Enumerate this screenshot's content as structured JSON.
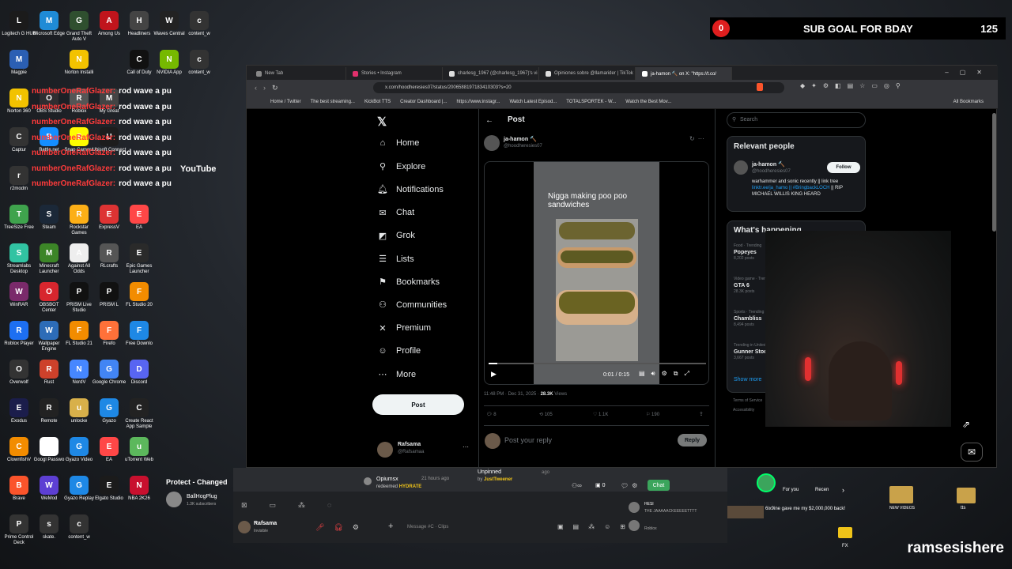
{
  "overlay": {
    "sub_goal_count": "0",
    "sub_goal_label": "SUB GOAL FOR BDAY",
    "sub_goal_target": "125",
    "brand": "ramsesishere",
    "youtube": "YouTube"
  },
  "desktop_icons": [
    {
      "label": "Logitech G HUB",
      "color": "#1b1b1b"
    },
    {
      "label": "Microsoft Edge",
      "color": "#1f8bd6"
    },
    {
      "label": "Grand Theft Auto V",
      "color": "#2f4f2f"
    },
    {
      "label": "Among Us",
      "color": "#c0141c"
    },
    {
      "label": "Headliners",
      "color": "#444"
    },
    {
      "label": "Waves Central",
      "color": "#222"
    },
    {
      "label": "content_w",
      "color": "#333"
    },
    {
      "label": "Magpie",
      "color": "#2b5fb3"
    },
    {
      "label": "Norton Installi",
      "color": "#f2c200"
    },
    {
      "label": "Call of Duty",
      "color": "#111"
    },
    {
      "label": "NVIDIA App",
      "color": "#76b900"
    },
    {
      "label": "content_w",
      "color": "#333"
    },
    {
      "label": "Norton 360",
      "color": "#f2c200"
    },
    {
      "label": "OBS Studio",
      "color": "#302e31"
    },
    {
      "label": "Roblox",
      "color": "#555"
    },
    {
      "label": "My Great",
      "color": "#444"
    },
    {
      "label": "Captur",
      "color": "#333"
    },
    {
      "label": "Battle.net",
      "color": "#148eff"
    },
    {
      "label": "Snap Camera",
      "color": "#fffc00"
    },
    {
      "label": "Ubisoft Connect",
      "color": "#1d1d1d"
    },
    {
      "label": "r2modm",
      "color": "#333"
    },
    {
      "label": "TreeSize Free",
      "color": "#3fa34d"
    },
    {
      "label": "Steam",
      "color": "#1b2838"
    },
    {
      "label": "Rockstar Games",
      "color": "#fcaf17"
    },
    {
      "label": "ExpressV",
      "color": "#d33"
    },
    {
      "label": "EA",
      "color": "#ff4747"
    },
    {
      "label": "Streamlabs Desktop",
      "color": "#31c3a2"
    },
    {
      "label": "Minecraft Launcher",
      "color": "#3c8527"
    },
    {
      "label": "Against All Odds",
      "color": "#eee"
    },
    {
      "label": "RLcrafts",
      "color": "#555"
    },
    {
      "label": "Epic Games Launcher",
      "color": "#2a2a2a"
    },
    {
      "label": "WinRAR",
      "color": "#7a2a6a"
    },
    {
      "label": "OBSBOT Center",
      "color": "#d7262e"
    },
    {
      "label": "PRISM Live Studio",
      "color": "#111"
    },
    {
      "label": "PRISM L",
      "color": "#111"
    },
    {
      "label": "FL Studio 20",
      "color": "#f28c00"
    },
    {
      "label": "Roblox Player",
      "color": "#1d6ff2"
    },
    {
      "label": "Wallpaper Engine",
      "color": "#2d6cb7"
    },
    {
      "label": "FL Studio 21",
      "color": "#f28c00"
    },
    {
      "label": "Firefo",
      "color": "#ff7139"
    },
    {
      "label": "Free Downlo",
      "color": "#1e88e5"
    },
    {
      "label": "Overwolf",
      "color": "#333"
    },
    {
      "label": "Rust",
      "color": "#cd412b"
    },
    {
      "label": "NordV",
      "color": "#4687ff"
    },
    {
      "label": "Google Chrome",
      "color": "#4285f4"
    },
    {
      "label": "Discord",
      "color": "#5865f2"
    },
    {
      "label": "Exodus",
      "color": "#1b1d4b"
    },
    {
      "label": "Remote",
      "color": "#222"
    },
    {
      "label": "unlocke",
      "color": "#d8b04a"
    },
    {
      "label": "Gyazo",
      "color": "#1e88e5"
    },
    {
      "label": "Create React App Sample",
      "color": "#222"
    },
    {
      "label": "ClownfishV",
      "color": "#f28c00"
    },
    {
      "label": "Googl Passwo",
      "color": "#fff"
    },
    {
      "label": "Gyazo Video",
      "color": "#1e88e5"
    },
    {
      "label": "EA",
      "color": "#ff4747"
    },
    {
      "label": "uTorrent Web",
      "color": "#5cb85c"
    },
    {
      "label": "Brave",
      "color": "#fb542b"
    },
    {
      "label": "WeMod",
      "color": "#5d3fd3"
    },
    {
      "label": "Gyazo Replay",
      "color": "#1e88e5"
    },
    {
      "label": "Elgato Studio",
      "color": "#1b1b1b"
    },
    {
      "label": "NBA 2K26",
      "color": "#c8102e"
    },
    {
      "label": "Prime Control Deck",
      "color": "#333"
    },
    {
      "label": "skate.",
      "color": "#333"
    },
    {
      "label": "content_w",
      "color": "#333"
    }
  ],
  "chat_lines": [
    {
      "user": "numberOneRafGlazer:",
      "msg": "rod wave a pu"
    },
    {
      "user": "numberOneRafGlazer:",
      "msg": "rod wave a pu"
    },
    {
      "user": "numberOneRafGlazer:",
      "msg": "rod wave a pu"
    },
    {
      "user": "numberOneRafGlazer:",
      "msg": "rod wave a pu"
    },
    {
      "user": "numberOneRafGlazer:",
      "msg": "rod wave a pu"
    },
    {
      "user": "numberOneRafGlazer:",
      "msg": "rod wave a pu"
    },
    {
      "user": "numberOneRafGlazer:",
      "msg": "rod wave a pu"
    }
  ],
  "browser": {
    "tabs": [
      {
        "label": "New Tab",
        "color": "#888"
      },
      {
        "label": "Stories • Instagram",
        "color": "#e1306c"
      },
      {
        "label": "charlesg_1967 (@charlesg_1967)'s vi",
        "color": "#ddd"
      },
      {
        "label": "Opiniones sobre @llamarider | TikTok",
        "color": "#ddd"
      },
      {
        "label": "ja-hamon 🔨 on X: \"https://t.co/",
        "color": "#fff"
      }
    ],
    "url": "x.com/hoodheresies07/status/2006588197183410303?s=20",
    "bookmarks": [
      "Home / Twitter",
      "The best streaming...",
      "KickBot TTS",
      "Creator Dashboard |...",
      "https://www.instagr...",
      "Watch Latest Episod...",
      "TOTALSPORTEK - W...",
      "Watch the Best Mov..."
    ],
    "all_bookmarks": "All Bookmarks"
  },
  "twitter": {
    "nav": [
      {
        "label": "Home",
        "icon": "home-icon",
        "glyph": "⌂"
      },
      {
        "label": "Explore",
        "icon": "search-icon",
        "glyph": "⚲"
      },
      {
        "label": "Notifications",
        "icon": "bell-icon",
        "glyph": "🔔︎"
      },
      {
        "label": "Chat",
        "icon": "chat-icon",
        "glyph": "✉"
      },
      {
        "label": "Grok",
        "icon": "grok-icon",
        "glyph": "◩"
      },
      {
        "label": "Lists",
        "icon": "lists-icon",
        "glyph": "☰"
      },
      {
        "label": "Bookmarks",
        "icon": "bookmark-icon",
        "glyph": "⚑"
      },
      {
        "label": "Communities",
        "icon": "communities-icon",
        "glyph": "⚇"
      },
      {
        "label": "Premium",
        "icon": "x-icon",
        "glyph": "✕"
      },
      {
        "label": "Profile",
        "icon": "profile-icon",
        "glyph": "☺"
      },
      {
        "label": "More",
        "icon": "more-icon",
        "glyph": "⋯"
      }
    ],
    "post_button": "Post",
    "account_name": "Rafsama",
    "account_handle": "@Rafsamaa",
    "header_title": "Post",
    "author_name": "ja-hamon 🔨",
    "author_handle": "@hoodheresies07",
    "video_caption": "Nigga making poo poo sandwiches",
    "video_time": "0:01 / 0:15",
    "post_meta_time": "11:48 PM · Dec 31, 2025 · ",
    "post_views": "28.3K",
    "post_views_label": " Views",
    "replies": "8",
    "reposts": "105",
    "likes": "1.1K",
    "bookmarks": "190",
    "reply_placeholder": "Post your reply",
    "reply_button": "Reply",
    "search_placeholder": "Search",
    "relevant_people_title": "Relevant people",
    "rp_name": "ja-hamon 🔨",
    "rp_handle": "@hoodheresies07",
    "rp_follow": "Follow",
    "rp_bio_1": "warhammer and sonic recently || link tree ",
    "rp_bio_link": "linktr.ee/ja_hamo || #BringbackLOCH",
    "rp_bio_2": " || RIP MICHAEL WILLIS KING HEARD",
    "whats_happening": "What's happening",
    "trends": [
      {
        "cat": "Food · Trending",
        "name": "Popeyes",
        "posts": "8,202 posts"
      },
      {
        "cat": "Video game · Trending",
        "name": "GTA 6",
        "posts": "28.3K posts"
      },
      {
        "cat": "Sports · Trending",
        "name": "Chambliss",
        "posts": "8,494 posts"
      },
      {
        "cat": "Trending in United States",
        "name": "Gunner Stoc",
        "posts": "3,667 posts"
      }
    ],
    "show_more": "Show more",
    "terms": "Terms of Service",
    "accessibility": "Accessibility"
  },
  "discord": {
    "user": "Rafsama",
    "status": "Invisible",
    "channel_name": "Opiumsx",
    "redeemed": "redeemed ",
    "redeem_item": "HYDRATE",
    "redeem_time": "21 hours ago",
    "unpinned": "Unpinned",
    "unpinned_by": "by ",
    "unpinned_user": "JustTweener",
    "unpinned_time": "ago",
    "message_placeholder": "Message #C · Clips",
    "chat_btn": "Chat",
    "count_a": "0",
    "count_b": "0",
    "friend_a": "HESI",
    "friend_a_sub": "THE JAAAAACKEEEEETTTT",
    "friend_b": "Roblox",
    "protect_title": "Protect - Changed",
    "yt_channel": "BallHogPlug",
    "yt_subs": "1.3K subscribers",
    "for_you": "For you",
    "recent": "Recen",
    "notif_text": "6ix9ine gave me my $2,000,000 back!",
    "new_videos": "NEW VIDEOS",
    "folder_tts": "tts",
    "folder_fx": "FX"
  }
}
